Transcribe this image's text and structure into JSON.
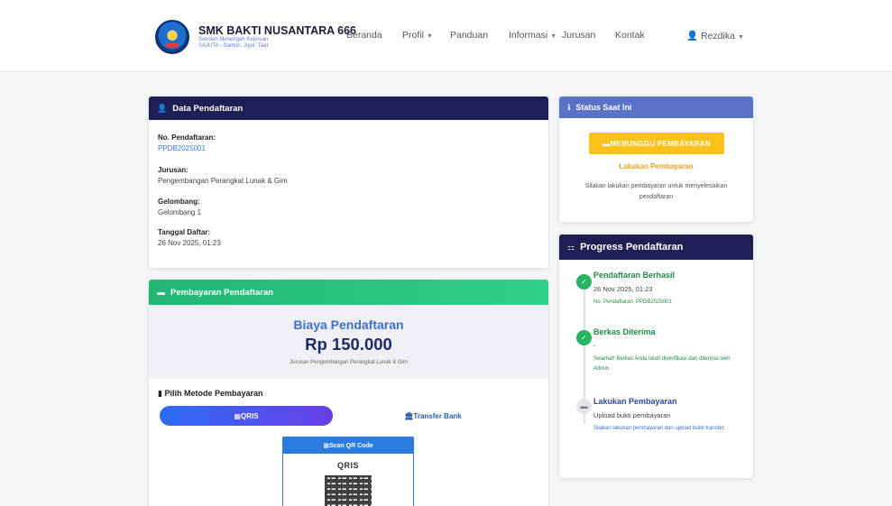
{
  "brand": {
    "name": "SMK BAKTI NUSANTARA 666",
    "sub1": "Sekolah Menengah Kejuruan",
    "sub2": "SAJUTA - Santun, Jujur, Taat"
  },
  "nav": {
    "beranda": "Beranda",
    "profil": "Profil",
    "panduan": "Panduan",
    "informasi": "Informasi",
    "jurusan": "Jurusan",
    "kontak": "Kontak",
    "user": "Rezdika"
  },
  "data_card": {
    "title": "Data Pendaftaran",
    "no_label": "No. Pendaftaran:",
    "no_value": "PPDB2025001",
    "jurusan_label": "Jurusan:",
    "jurusan_value": "Pengembangan Perangkat Lunak & Gim",
    "gelombang_label": "Gelombang:",
    "gelombang_value": "Gelombang 1",
    "tanggal_label": "Tanggal Daftar:",
    "tanggal_value": "26 Nov 2025, 01:23"
  },
  "payment": {
    "title": "Pembayaran Pendaftaran",
    "fee_title": "Biaya Pendaftaran",
    "fee_amount": "Rp 150.000",
    "fee_note": "Jurusan Pengembangan Perangkat Lunak & Gim",
    "method_title": "Pilih Metode Pembayaran",
    "tab_qris": "QRIS",
    "tab_bank": "Transfer Bank",
    "qr_header": "Scan QR Code",
    "qris_logo": "QRIS"
  },
  "status": {
    "title": "Status Saat Ini",
    "badge": "MENUNGGU PEMBAYARAN",
    "action": "Lakukan Pembayaran",
    "desc": "Silakan lakukan pembayaran untuk menyelesaikan pendaftaran"
  },
  "progress": {
    "title": "Progress Pendaftaran",
    "steps": [
      {
        "title": "Pendaftaran Berhasil",
        "sub": "26 Nov 2025, 01:23",
        "note": "No. Pendaftaran: PPDB2025001"
      },
      {
        "title": "Berkas Diterima",
        "sub": "-",
        "note": "Selamat! Berkas Anda telah diverifikasi dan diterima oleh Admin."
      },
      {
        "title": "Lakukan Pembayaran",
        "sub": "Upload bukti pembayaran",
        "note": "Silakan lakukan pembayaran dan upload bukti transfer."
      }
    ]
  },
  "colors": {
    "navy": "#1e1f55",
    "green": "#28b463",
    "amber": "#ffc21a",
    "blue": "#3c6fcf",
    "status_head": "#5b72c9"
  }
}
